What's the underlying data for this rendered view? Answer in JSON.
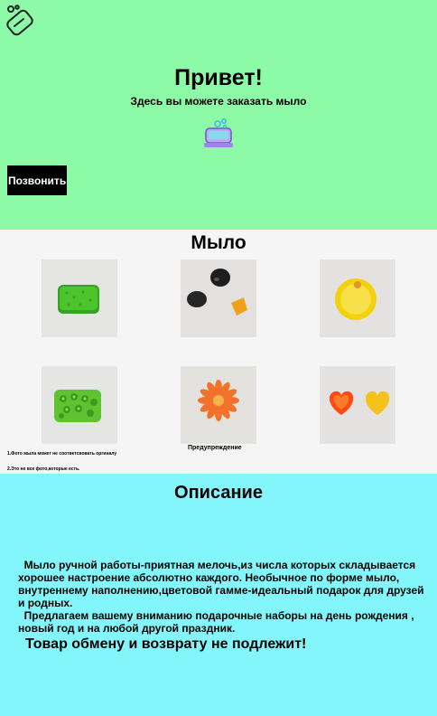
{
  "hero": {
    "title": "Привет!",
    "subtitle": "Здесь вы можете заказать мыло",
    "call_button": "Позвонить",
    "logo_icon": "soap-bar-icon",
    "soap_icon": "soap-dish-icon",
    "background": "#8cfaa6"
  },
  "gallery": {
    "title": "Мыло",
    "photos": [
      {
        "name": "green-rectangle-soap"
      },
      {
        "name": "black-and-orange-soap-pieces"
      },
      {
        "name": "yellow-round-soap"
      },
      {
        "name": "green-floral-rectangle-soap"
      },
      {
        "name": "orange-daisy-soap"
      },
      {
        "name": "orange-and-yellow-heart-soaps"
      }
    ],
    "caption_center": "Предупреждение",
    "note_1": "1.Фото мыла может не соответсвовать оргиналу",
    "note_2": "2.Это не все фото,которые есть.",
    "background": "#f5f5f6"
  },
  "description": {
    "title": "Описание",
    "paragraph_1": "Мыло ручной работы-приятная мелочь,из числа которых складывается хорошее настроение абсолютно каждого. Необычное по форме мыло, внутреннему наполнению,цветовой гамме-идеальный подарок для друзей и родных.",
    "paragraph_2": "Предлагаем вашему вниманию подарочные наборы на день рождения , новый год и на любой другой праздник.",
    "warning": "Товар обмену и возврату не подлежит!",
    "background": "#82f6fb"
  }
}
